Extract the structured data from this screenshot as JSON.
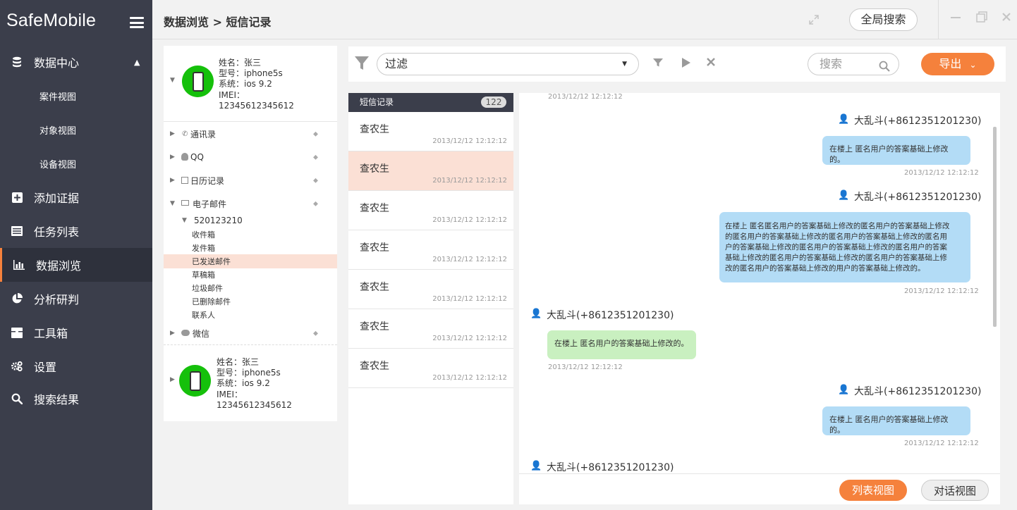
{
  "app": {
    "brand": "SafeMobile"
  },
  "nav": {
    "data_center": "数据中心",
    "sub": [
      "案件视图",
      "对象视图",
      "设备视图"
    ],
    "add_evidence": "添加证据",
    "task_list": "任务列表",
    "data_browse": "数据浏览",
    "analysis": "分析研判",
    "toolbox": "工具箱",
    "settings": "设置",
    "search_results": "搜索结果"
  },
  "header": {
    "breadcrumb": "数据浏览 > 短信记录",
    "global_search": "全局搜索"
  },
  "devices": [
    {
      "name": "姓名：张三",
      "model": "型号：iphone5s",
      "system": "系统：ios 9.2",
      "imei_label": "IMEI：",
      "imei": "12345612345612"
    },
    {
      "name": "姓名：张三",
      "model": "型号：iphone5s",
      "system": "系统：ios 9.2",
      "imei_label": "IMEI：",
      "imei": "12345612345612"
    }
  ],
  "tree": {
    "contacts": "通讯录",
    "qq": "QQ",
    "calendar": "日历记录",
    "email": "电子邮件",
    "account": "520123210",
    "folders": [
      "收件箱",
      "发件箱",
      "已发送邮件",
      "草稿箱",
      "垃圾邮件",
      "已删除邮件",
      "联系人"
    ],
    "wechat": "微信"
  },
  "toolbar": {
    "filter_label": "过滤",
    "search_placeholder": "搜索",
    "export_label": "导出"
  },
  "sms_list": {
    "title": "短信记录",
    "count": "122",
    "items": [
      {
        "name": "查农生",
        "time": "2013/12/12 12:12:12"
      },
      {
        "name": "查农生",
        "time": "2013/12/12 12:12:12"
      },
      {
        "name": "查农生",
        "time": "2013/12/12 12:12:12"
      },
      {
        "name": "查农生",
        "time": "2013/12/12 12:12:12"
      },
      {
        "name": "查农生",
        "time": "2013/12/12 12:12:12"
      },
      {
        "name": "查农生",
        "time": "2013/12/12 12:12:12"
      },
      {
        "name": "查农生",
        "time": "2013/12/12 12:12:12"
      }
    ]
  },
  "conversation": {
    "top_time": "2013/12/12 12:12:12",
    "messages": [
      {
        "sender": "大乱斗(+8612351201230)",
        "text": "在楼上 匿名用户的答案基础上修改的。",
        "time": "2013/12/12 12:12:12"
      },
      {
        "sender": "大乱斗(+8612351201230)",
        "text_lines": [
          "在楼上 匿名匿名用户的答案基础上修改的匿名用户的答案基础上修改",
          "的匿名用户的答案基础上修改的匿名用户的答案基础上修改的匿名用",
          "户的答案基础上修改的匿名用户的答案基础上修改的匿名用户的答案",
          "基础上修改的匿名用户的答案基础上修改的匿名用户的答案基础上修",
          "改的匿名用户的答案基础上修改的用户的答案基础上修改的。"
        ],
        "time": "2013/12/12 12:12:12"
      },
      {
        "sender": "大乱斗(+8612351201230)",
        "text": "在楼上 匿名用户的答案基础上修改的。",
        "time": "2013/12/12 12:12:12"
      },
      {
        "sender": "大乱斗(+8612351201230)",
        "text": "在楼上 匿名用户的答案基础上修改的。",
        "time": "2013/12/12 12:12:12"
      },
      {
        "sender": "大乱斗(+8612351201230)"
      }
    ]
  },
  "footer": {
    "list_view": "列表视图",
    "dialog_view": "对话视图"
  },
  "colors": {
    "sidebar": "#3b3e4b",
    "accent": "#f5813c",
    "selected_row": "#fbe0d5",
    "bubble_blue": "#b3dcf6",
    "bubble_green": "#c9f0c0",
    "avatar_green": "#15c00b"
  }
}
